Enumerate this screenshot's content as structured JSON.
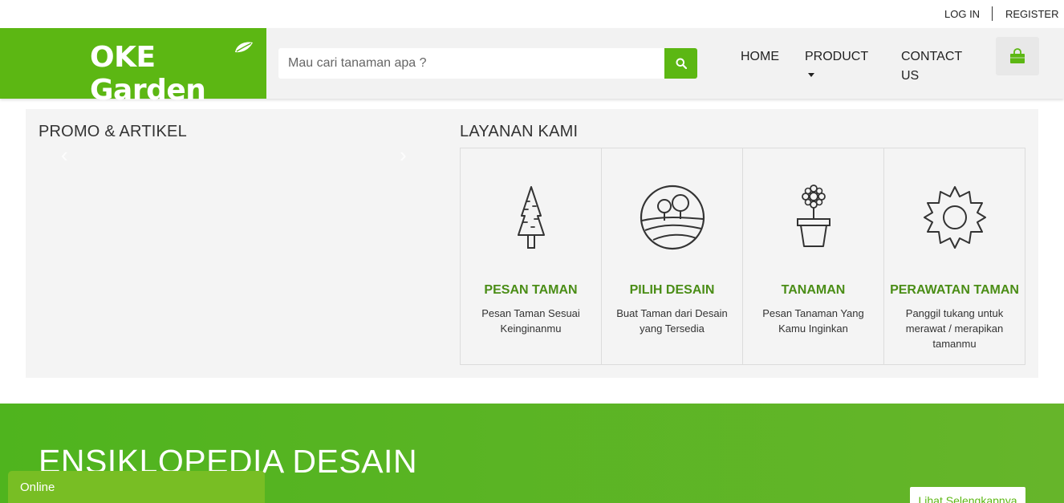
{
  "topbar": {
    "login": "LOG IN",
    "register": "REGISTER"
  },
  "brand": {
    "name": "OKE Garden",
    "color": "#5cb713"
  },
  "search": {
    "placeholder": "Mau cari tanaman apa ?",
    "value": "",
    "icon": "search-icon"
  },
  "nav": {
    "home": "HOME",
    "product": "PRODUCT",
    "contact_line1": "CONTACT",
    "contact_line2": "US",
    "cart_icon": "shopping-bag-icon"
  },
  "promo": {
    "title": "PROMO & ARTIKEL",
    "prev": "‹",
    "next": "›"
  },
  "services": {
    "title": "LAYANAN KAMI",
    "items": [
      {
        "icon": "tree-icon",
        "title": "PESAN TAMAN",
        "desc": "Pesan Taman Sesuai Keinginanmu"
      },
      {
        "icon": "landscape-icon",
        "title": "PILIH DESAIN",
        "desc": "Buat Taman dari Desain yang Tersedia"
      },
      {
        "icon": "flower-pot-icon",
        "title": "TANAMAN",
        "desc": "Pesan Tanaman Yang Kamu Inginkan"
      },
      {
        "icon": "gear-icon",
        "title": "PERAWATAN TAMAN",
        "desc": "Panggil tukang untuk merawat / merapikan tamanmu"
      }
    ]
  },
  "ensiklopedia": {
    "title": "ENSIKLOPEDIA DESAIN",
    "more": "Lihat Selengkapnya"
  },
  "chat": {
    "status": "Online"
  }
}
